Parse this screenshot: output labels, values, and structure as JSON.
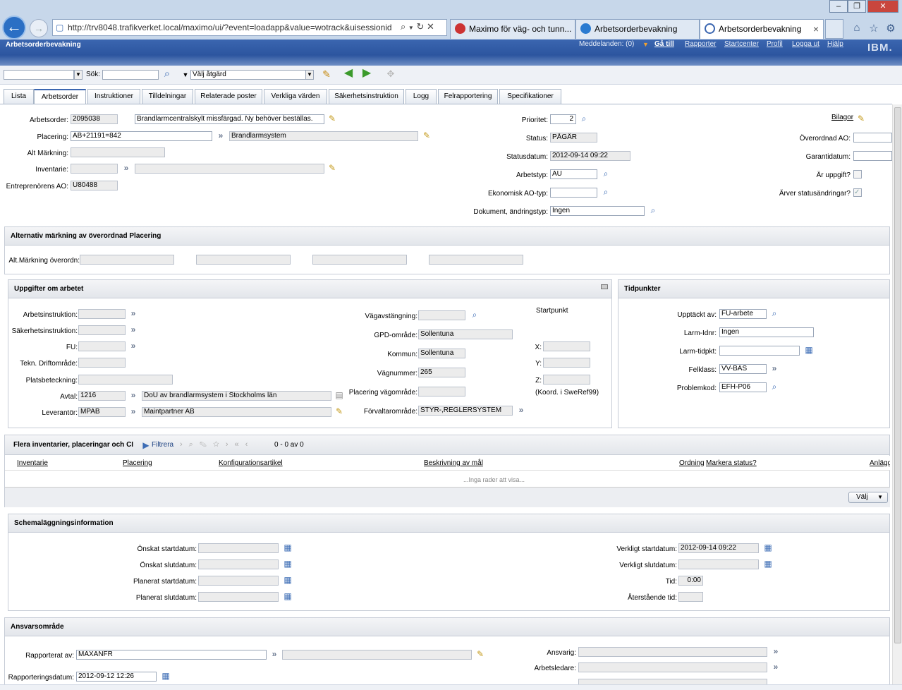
{
  "browser": {
    "url": "http://trv8048.trafikverket.local/maximo/ui/?event=loadapp&value=wotrack&uisessionid",
    "tabs": [
      {
        "label": "Maximo för väg- och tunn..."
      },
      {
        "label": "Arbetsorderbevakning"
      },
      {
        "label": "Arbetsorderbevakning"
      }
    ],
    "tab_close": "×"
  },
  "app": {
    "title": "Arbetsorderbevakning",
    "header_links": {
      "messages": "Meddelanden: (0)",
      "goto": "Gå till",
      "reports": "Rapporter",
      "startcenter": "Startcenter",
      "profile": "Profil",
      "logout": "Logga ut",
      "help": "Hjälp"
    },
    "brand": "IBM.",
    "colors": {
      "header": "#2c559f",
      "accent": "#3d6db5"
    }
  },
  "toolbar": {
    "search_label": "Sök:",
    "action_select": "Välj åtgärd"
  },
  "tabs": [
    "Lista",
    "Arbetsorder",
    "Instruktioner",
    "Tilldelningar",
    "Relaterade poster",
    "Verkliga värden",
    "Säkerhetsinstruktion",
    "Logg",
    "Felrapportering",
    "Specifikationer"
  ],
  "main": {
    "arbetsorder_label": "Arbetsorder:",
    "arbetsorder": "2095038",
    "description": "Brandlarmcentralskylt missfärgad. Ny behöver beställas.",
    "placering_label": "Placering:",
    "placering": "AB+21191=842",
    "placering_desc": "Brandlarmsystem",
    "alt_markning_label": "Alt Märkning:",
    "inventarie_label": "Inventarie:",
    "entreprenor_label": "Entreprenörens AO:",
    "entreprenor": "U80488",
    "prioritet_label": "Prioritet:",
    "prioritet": "2",
    "status_label": "Status:",
    "status": "PÅGÅR",
    "statusdatum_label": "Statusdatum:",
    "statusdatum": "2012-09-14 09:22",
    "arbetstyp_label": "Arbetstyp:",
    "arbetstyp": "AU",
    "ekonomisk_label": "Ekonomisk AO-typ:",
    "dokument_label": "Dokument, ändringstyp:",
    "dokument": "Ingen",
    "bilagor": "Bilagor",
    "overordnad_label": "Överordnad AO:",
    "garanti_label": "Garantidatum:",
    "ar_uppgift_label": "Är uppgift?",
    "arver_label": "Ärver statusändringar?"
  },
  "alt_section": {
    "title": "Alternativ märkning av överordnad Placering",
    "label": "Alt.Märkning överordn:"
  },
  "uppgifter": {
    "title": "Uppgifter om arbetet",
    "arbetsinstruktion": "Arbetsinstruktion:",
    "sakerhetsinstruktion": "Säkerhetsinstruktion:",
    "fu": "FU:",
    "tekn": "Tekn. Driftområde:",
    "plats": "Platsbeteckning:",
    "avtal_label": "Avtal:",
    "avtal": "1216",
    "avtal_desc": "DoU av brandlarmsystem i Stockholms län",
    "leverantor_label": "Leverantör:",
    "leverantor": "MPAB",
    "leverantor_desc": "Maintpartner AB",
    "vagavstangning": "Vägavstängning:",
    "gpd_label": "GPD-område:",
    "gpd": "Sollentuna",
    "kommun_label": "Kommun:",
    "kommun": "Sollentuna",
    "vagnummer_label": "Vägnummer:",
    "vagnummer": "265",
    "placering_vagomrade": "Placering vägområde:",
    "forvaltar_label": "Förvaltarområde:",
    "forvaltar": "STYR-,REGLERSYSTEM",
    "startpunkt": "Startpunkt",
    "x": "X:",
    "y": "Y:",
    "z": "Z:",
    "koord": "(Koord. i SweRef99)"
  },
  "tidpunkter": {
    "title": "Tidpunkter",
    "upptackt_label": "Upptäckt av:",
    "upptackt": "FU-arbete",
    "larm_idnr_label": "Larm-Idnr:",
    "larm_idnr": "Ingen",
    "larm_tidpkt_label": "Larm-tidpkt:",
    "felklass_label": "Felklass:",
    "felklass": "VV-BAS",
    "problemkod_label": "Problemkod:",
    "problemkod": "EFH-P06"
  },
  "flera": {
    "title": "Flera inventarier, placeringar och CI",
    "filter": "Filtrera",
    "count": "0 - 0 av 0",
    "columns": [
      "Inventarie",
      "Placering",
      "Konfigurationsartikel",
      "Beskrivning av mål",
      "Ordning",
      "Markera status?",
      "Anläggning"
    ],
    "empty": "...Inga rader att visa...",
    "select": "Välj"
  },
  "schema": {
    "title": "Schemaläggningsinformation",
    "onskat_start": "Önskat startdatum:",
    "onskat_slut": "Önskat slutdatum:",
    "planerat_start": "Planerat startdatum:",
    "planerat_slut": "Planerat slutdatum:",
    "verkligt_start_label": "Verkligt startdatum:",
    "verkligt_start": "2012-09-14 09:22",
    "verkligt_slut_label": "Verkligt slutdatum:",
    "tid_label": "Tid:",
    "tid": "0:00",
    "aterstaende": "Återstående tid:"
  },
  "ansvar": {
    "title": "Ansvarsområde",
    "rapporterat_label": "Rapporterat av:",
    "rapporterat": "MAXANFR",
    "rapportdatum_label": "Rapporteringsdatum:",
    "rapportdatum": "2012-09-12 12:26",
    "ansvarig": "Ansvarig:",
    "arbetsledare": "Arbetsledare:"
  }
}
